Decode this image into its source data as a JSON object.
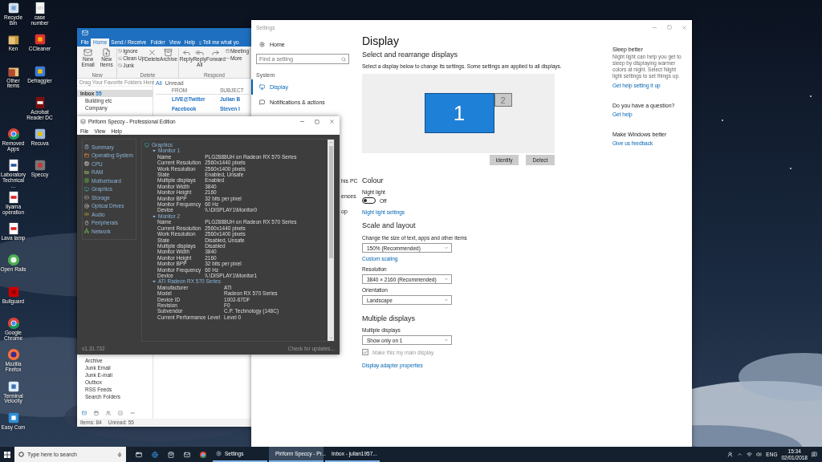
{
  "desktop": {
    "icons": [
      {
        "label": "Recycle Bin"
      },
      {
        "label": "case number"
      },
      {
        "label": "Ken"
      },
      {
        "label": "CCleaner"
      },
      {
        "label": "Other items"
      },
      {
        "label": "Defraggler"
      },
      {
        "label": "Acrobat Reader DC"
      },
      {
        "label": "Removed Apps"
      },
      {
        "label": "Recuva"
      },
      {
        "label": "Laboratory Technical ..."
      },
      {
        "label": "Speccy"
      },
      {
        "label": "Iiyama operation"
      },
      {
        "label": "Lava lamp"
      },
      {
        "label": "Open Rails"
      },
      {
        "label": "Bullguard"
      },
      {
        "label": "Google Chrome"
      },
      {
        "label": "Mozilla Firefox"
      },
      {
        "label": "Terminal Velocity"
      },
      {
        "label": "Easy Com"
      }
    ]
  },
  "outlook": {
    "tabs": [
      {
        "label": "File",
        "selected": false
      },
      {
        "label": "Home",
        "selected": true
      },
      {
        "label": "Send / Receive",
        "selected": false
      },
      {
        "label": "Folder",
        "selected": false
      },
      {
        "label": "View",
        "selected": false
      },
      {
        "label": "Help",
        "selected": false
      }
    ],
    "tell_me": "Tell me what yo",
    "ribbon_groups": [
      {
        "label": "New",
        "buttons": [
          {
            "label": "New Email",
            "kind": "large"
          },
          {
            "label": "New Items",
            "kind": "large"
          }
        ]
      },
      {
        "label": "Delete",
        "buttons": [
          {
            "label": "Ignore",
            "kind": "small"
          },
          {
            "label": "Clean Up",
            "kind": "small"
          },
          {
            "label": "Junk",
            "kind": "small"
          },
          {
            "label": "Delete",
            "kind": "large"
          },
          {
            "label": "Archive",
            "kind": "large"
          }
        ]
      },
      {
        "label": "Respond",
        "buttons": [
          {
            "label": "Reply",
            "kind": "large"
          },
          {
            "label": "Reply All",
            "kind": "large"
          },
          {
            "label": "Forward",
            "kind": "large"
          },
          {
            "label": "Meeting",
            "kind": "small"
          },
          {
            "label": "More",
            "kind": "small"
          }
        ]
      }
    ],
    "favorites_hint": "Drag Your Favorite Folders Here",
    "folders": [
      {
        "label": "Inbox",
        "count": "55",
        "selected": true
      },
      {
        "label": "Building etc",
        "selected": false
      },
      {
        "label": "Company",
        "selected": false
      }
    ],
    "more_folders": [
      {
        "label": "Archive"
      },
      {
        "label": "Junk Email"
      },
      {
        "label": "Junk E-mail"
      },
      {
        "label": "Outbox"
      },
      {
        "label": "RSS Feeds"
      },
      {
        "label": "Search Folders"
      }
    ],
    "filters": [
      {
        "label": "All",
        "selected": true
      },
      {
        "label": "Unread",
        "selected": false
      }
    ],
    "list_columns": [
      "FROM",
      "SUBJECT"
    ],
    "messages": [
      {
        "from": "LIVE@Twitter",
        "subject": "Julian B"
      },
      {
        "from": "Facebook",
        "subject": "Steven I"
      }
    ],
    "status": [
      "Items: 84",
      "Unread: 55"
    ]
  },
  "settings": {
    "title": "Settings",
    "home": "Home",
    "search": {
      "placeholder": "Find a setting"
    },
    "section": "System",
    "nav": [
      {
        "label": "Display",
        "selected": true
      },
      {
        "label": "Notifications & actions",
        "selected": false
      }
    ],
    "nav_partial": [
      "his PC",
      "ences",
      "op"
    ],
    "heading": "Display",
    "arrange_title": "Select and rearrange displays",
    "arrange_hint": "Select a display below to change its settings. Some settings are applied to all displays.",
    "monitors": [
      {
        "label": "1",
        "selected": true
      },
      {
        "label": "2",
        "selected": false
      }
    ],
    "arrange_buttons": [
      "Identify",
      "Detect"
    ],
    "colour": {
      "heading": "Colour",
      "night_light_label": "Night light",
      "night_light": {
        "on": false,
        "state": "Off"
      },
      "link": "Night light settings"
    },
    "scale": {
      "heading": "Scale and layout",
      "size_label": "Change the size of text, apps and other items",
      "size_value": "150% (Recommended)",
      "custom_link": "Custom scaling",
      "resolution_label": "Resolution",
      "resolution_value": "3840 × 2160 (Recommended)",
      "orientation_label": "Orientation",
      "orientation_value": "Landscape"
    },
    "multiple": {
      "heading": "Multiple displays",
      "label": "Multiple displays",
      "value": "Show only on 1",
      "main_display": {
        "label": "Make this my main display",
        "checked": true,
        "disabled": true
      },
      "link": "Display adapter properties"
    },
    "side": [
      {
        "title": "Sleep better",
        "text": "Night light can help you get to sleep by displaying warmer colors at night. Select Night light settings to set things up.",
        "link": "Get help setting it up"
      },
      {
        "title": "Do you have a question?",
        "link": "Get help"
      },
      {
        "title": "Make Windows better",
        "link": "Give us feedback"
      }
    ]
  },
  "speccy": {
    "title": "Piriform Speccy - Professional Edition",
    "menu": [
      "File",
      "View",
      "Help"
    ],
    "sidebar": [
      "Summary",
      "Operating System",
      "CPU",
      "RAM",
      "Motherboard",
      "Graphics",
      "Storage",
      "Optical Drives",
      "Audio",
      "Peripherals",
      "Network"
    ],
    "tree": {
      "label": "Graphics",
      "children": [
        {
          "label": "Monitor 1",
          "expanded": true,
          "props": [
            {
              "name": "Name",
              "value": "PLG2888UH on Radeon RX 570 Series"
            },
            {
              "name": "Current Resolution",
              "value": "2560x1440 pixels"
            },
            {
              "name": "Work Resolution",
              "value": "2560x1400 pixels"
            },
            {
              "name": "State",
              "value": "Enabled, Unsafe"
            },
            {
              "name": "Multiple displays",
              "value": "Enabled"
            },
            {
              "name": "Monitor Width",
              "value": "3840"
            },
            {
              "name": "Monitor Height",
              "value": "2160"
            },
            {
              "name": "Monitor BPP",
              "value": "32 bits per pixel"
            },
            {
              "name": "Monitor Frequency",
              "value": "60 Hz"
            },
            {
              "name": "Device",
              "value": "\\\\.\\DISPLAY1\\Monitor0"
            }
          ]
        },
        {
          "label": "Monitor 2",
          "expanded": true,
          "props": [
            {
              "name": "Name",
              "value": "PLG2888UH on Radeon RX 570 Series"
            },
            {
              "name": "Current Resolution",
              "value": "2560x1440 pixels"
            },
            {
              "name": "Work Resolution",
              "value": "2560x1400 pixels"
            },
            {
              "name": "State",
              "value": "Disabled, Unsafe"
            },
            {
              "name": "Multiple displays",
              "value": "Disabled"
            },
            {
              "name": "Monitor Width",
              "value": "3840"
            },
            {
              "name": "Monitor Height",
              "value": "2160"
            },
            {
              "name": "Monitor BPP",
              "value": "32 bits per pixel"
            },
            {
              "name": "Monitor Frequency",
              "value": "60 Hz"
            },
            {
              "name": "Device",
              "value": "\\\\.\\DISPLAY1\\Monitor1"
            }
          ]
        },
        {
          "label": "ATI Radeon RX 570 Series",
          "expanded": true,
          "props": [
            {
              "name": "Manufacturer",
              "value": "ATI"
            },
            {
              "name": "Model",
              "value": "Radeon RX 570 Series"
            },
            {
              "name": "Device ID",
              "value": "1002-67DF"
            },
            {
              "name": "Revision",
              "value": "F0"
            },
            {
              "name": "Subvendor",
              "value": "C.P. Technology (148C)"
            },
            {
              "name": "Current Performance Level",
              "value": "Level 0"
            }
          ]
        }
      ]
    },
    "version": "v1.31.732",
    "update_link": "Check for updates..."
  },
  "taskbar": {
    "search": {
      "placeholder": "Type here to search"
    },
    "apps": [
      {
        "label": "Settings",
        "selected": false
      },
      {
        "label": "Piriform Speccy - Pr...",
        "selected": true
      },
      {
        "label": "Inbox - julian1957...",
        "selected": false
      }
    ],
    "language": "ENG",
    "time": "15:34",
    "date": "02/01/2018"
  }
}
